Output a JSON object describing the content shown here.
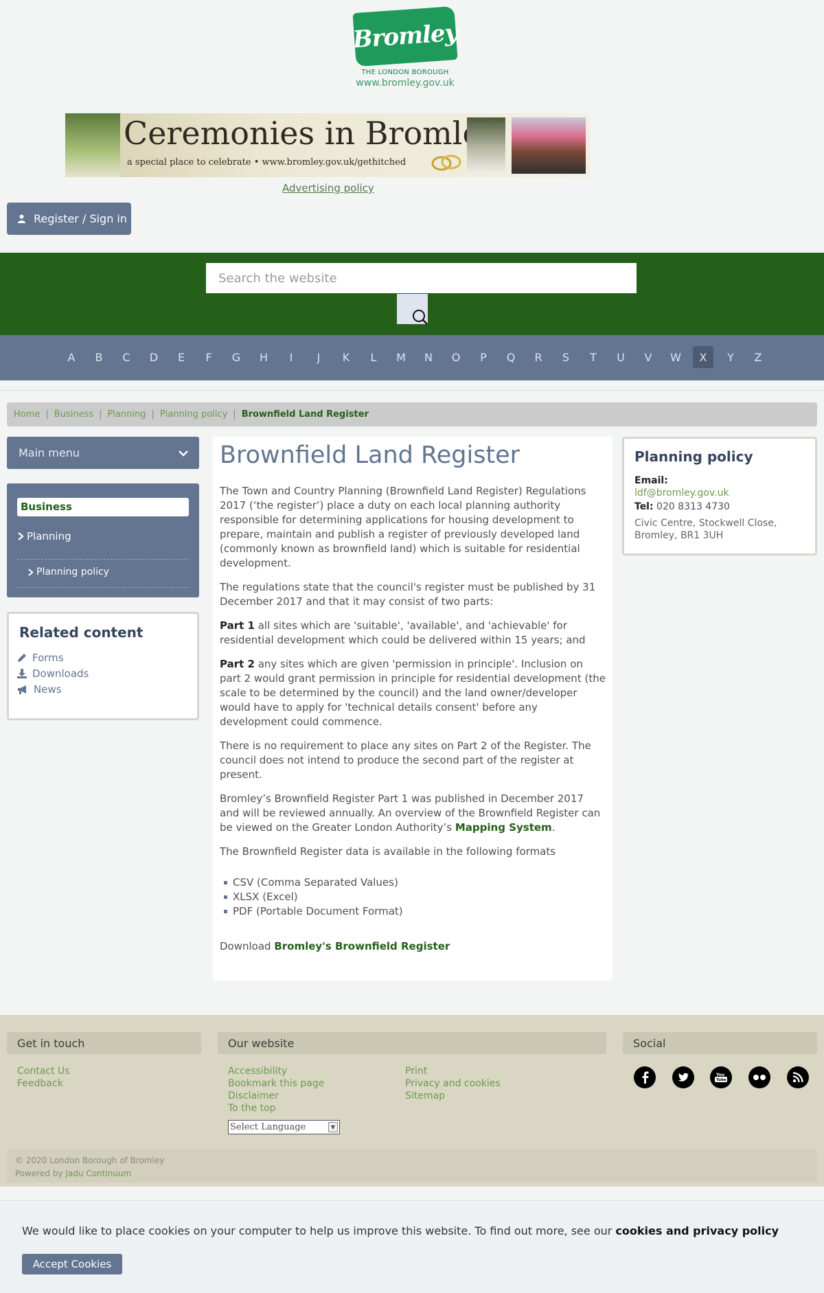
{
  "header": {
    "logo_text": "Bromley",
    "logo_subtitle": "THE LONDON BOROUGH",
    "logo_url": "www.bromley.gov.uk",
    "banner": {
      "title": "Ceremonies in Bromley",
      "tagline": "a special place to celebrate • www.bromley.gov.uk/gethitched"
    },
    "advertising_policy": "Advertising policy",
    "register_label": "Register / Sign in"
  },
  "search": {
    "placeholder": "Search the website"
  },
  "az": [
    "A",
    "B",
    "C",
    "D",
    "E",
    "F",
    "G",
    "H",
    "I",
    "J",
    "K",
    "L",
    "M",
    "N",
    "O",
    "P",
    "Q",
    "R",
    "S",
    "T",
    "U",
    "V",
    "W",
    "X",
    "Y",
    "Z"
  ],
  "az_active": "X",
  "breadcrumb": [
    "Home",
    "Business",
    "Planning",
    "Planning policy",
    "Brownfield Land Register"
  ],
  "sidebar": {
    "main_menu": "Main menu",
    "items": [
      {
        "label": "Business"
      },
      {
        "label": "Planning"
      },
      {
        "label": "Planning policy"
      }
    ],
    "related": {
      "title": "Related content",
      "items": [
        "Forms",
        "Downloads",
        "News"
      ]
    }
  },
  "content": {
    "title": "Brownfield Land Register",
    "p1": "The Town and Country Planning (Brownfield Land Register) Regulations 2017 (‘the register’) place a duty on each local planning authority responsible for determining applications for housing development to prepare, maintain and publish a register of previously developed land (commonly known as brownfield land) which is suitable for residential development.",
    "p2": "The regulations state that the council's register must be published by 31 December 2017 and that it may consist of two parts:",
    "part1_label": "Part 1",
    "part1_text": " all sites which are 'suitable', 'available', and 'achievable' for residential development which could be delivered within 15 years; and",
    "part2_label": "Part 2",
    "part2_text": "  any sites which are given 'permission in principle'. Inclusion on part 2 would grant permission in principle for residential development (the scale to be determined by the council) and the land owner/developer would have to apply for 'technical details consent' before any development could commence.",
    "p5": "There is no requirement to place any sites on Part 2 of the Register. The council does not intend to produce the second part of the register at present.",
    "p6_text": "Bromley’s Brownfield Register Part 1 was published in December 2017 and will be reviewed annually. An overview of the Brownfield Register can be viewed on the Greater London Authority’s ",
    "p6_link": "Mapping System",
    "p6_end": ".",
    "p7": "The Brownfield Register data is available in the following formats",
    "formats": [
      "CSV (Comma Separated Values)",
      "XLSX (Excel)",
      "PDF (Portable Document Format)"
    ],
    "download_prefix": "Download ",
    "download_link": "Bromley's Brownfield Register"
  },
  "aside": {
    "title": "Planning policy",
    "email_label": "Email:",
    "email": "ldf@bromley.gov.uk",
    "tel_label": "Tel:",
    "tel": "020 8313 4730",
    "address": "Civic Centre, Stockwell Close, Bromley, BR1 3UH"
  },
  "footer": {
    "get_in_touch": "Get in touch",
    "contact_links": [
      "Contact Us",
      "Feedback"
    ],
    "our_website": "Our website",
    "website_links_col1": [
      "Accessibility",
      "Bookmark this page",
      "Disclaimer",
      "To the top"
    ],
    "website_links_col2": [
      "Print",
      "Privacy and cookies",
      "Sitemap"
    ],
    "language_select": "Select Language",
    "social": "Social",
    "social_icons": [
      "facebook-icon",
      "twitter-icon",
      "youtube-icon",
      "flickr-icon",
      "rss-icon"
    ],
    "copyright": "© 2020 London Borough of Bromley",
    "powered_by": "Powered by",
    "powered_by_link": "Jadu Continuum"
  },
  "cookie": {
    "message": "We would like to place cookies on your computer to help us improve this website. To find out more, see our ",
    "link": "cookies and privacy policy",
    "accept": "Accept Cookies"
  },
  "colors": {
    "brand_green": "#246019",
    "slate": "#637591",
    "link_green": "#6c9a4f"
  }
}
